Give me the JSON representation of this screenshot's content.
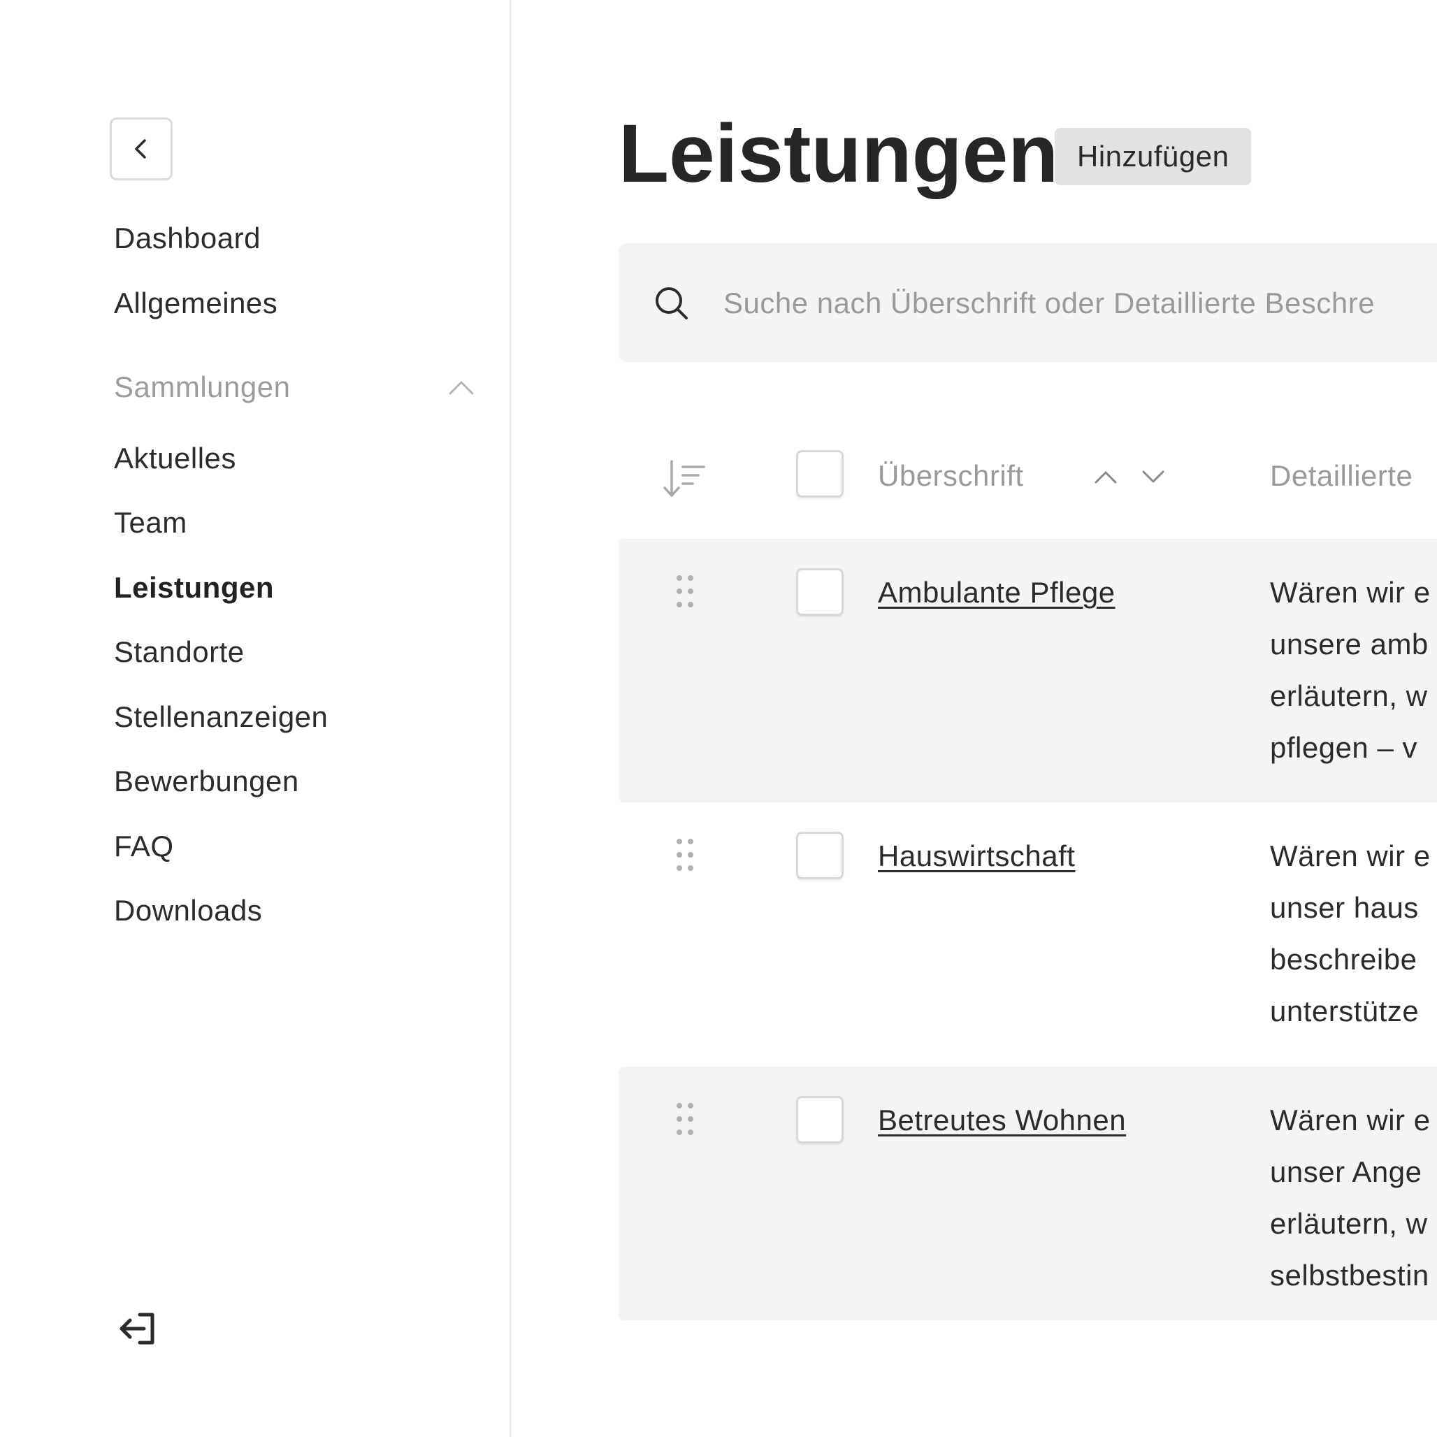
{
  "sidebar": {
    "nav": {
      "dashboard": "Dashboard",
      "allgemeines": "Allgemeines"
    },
    "section_label": "Sammlungen",
    "collections": [
      {
        "label": "Aktuelles",
        "active": false
      },
      {
        "label": "Team",
        "active": false
      },
      {
        "label": "Leistungen",
        "active": true
      },
      {
        "label": "Standorte",
        "active": false
      },
      {
        "label": "Stellenanzeigen",
        "active": false
      },
      {
        "label": "Bewerbungen",
        "active": false
      },
      {
        "label": "FAQ",
        "active": false
      },
      {
        "label": "Downloads",
        "active": false
      }
    ],
    "icons": {
      "back": "chevron-left-icon",
      "collapse": "chevron-up-icon",
      "logout": "logout-icon"
    }
  },
  "main": {
    "title": "Leistungen",
    "add_label": "Hinzufügen",
    "search": {
      "placeholder": "Suche nach Überschrift oder Detaillierte Beschre"
    },
    "table": {
      "columns": {
        "title": "Überschrift",
        "description": "Detaillierte"
      },
      "rows": [
        {
          "title": "Ambulante Pflege",
          "desc_lines": [
            "Wären wir e",
            "unsere amb",
            "erläutern, w",
            "pflegen – v"
          ]
        },
        {
          "title": "Hauswirtschaft",
          "desc_lines": [
            "Wären wir e",
            "unser haus",
            "beschreibe",
            "unterstütze"
          ]
        },
        {
          "title": "Betreutes Wohnen",
          "desc_lines": [
            "Wären wir e",
            "unser Ange",
            "erläutern, w",
            "selbstbestin"
          ]
        }
      ]
    }
  },
  "colors": {
    "text": "#2b2b2b",
    "muted": "#9a9a9a",
    "row_shade": "#f4f4f4",
    "button_bg": "#e2e2e2"
  }
}
